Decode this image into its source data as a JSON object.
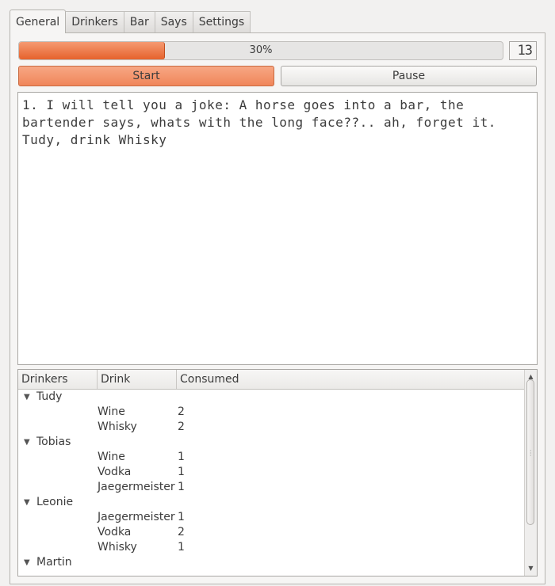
{
  "tabs": [
    {
      "label": "General",
      "active": true
    },
    {
      "label": "Drinkers",
      "active": false
    },
    {
      "label": "Bar",
      "active": false
    },
    {
      "label": "Says",
      "active": false
    },
    {
      "label": "Settings",
      "active": false
    }
  ],
  "progress": {
    "value": 0.3,
    "text": "30%"
  },
  "lcd": {
    "value": "13"
  },
  "buttons": {
    "start": "Start",
    "pause": "Pause"
  },
  "log": {
    "text": "1. I will tell you a joke: A horse goes into a bar, the bartender says, whats with the long face??.. ah, forget it. Tudy, drink Whisky"
  },
  "tree": {
    "columns": [
      "Drinkers",
      "Drink",
      "Consumed"
    ],
    "drinkers": [
      {
        "name": "Tudy",
        "drinks": [
          {
            "drink": "Wine",
            "consumed": "2"
          },
          {
            "drink": "Whisky",
            "consumed": "2"
          }
        ]
      },
      {
        "name": "Tobias",
        "drinks": [
          {
            "drink": "Wine",
            "consumed": "1"
          },
          {
            "drink": "Vodka",
            "consumed": "1"
          },
          {
            "drink": "Jaegermeister",
            "consumed": "1"
          }
        ]
      },
      {
        "name": "Leonie",
        "drinks": [
          {
            "drink": "Jaegermeister",
            "consumed": "1"
          },
          {
            "drink": "Vodka",
            "consumed": "2"
          },
          {
            "drink": "Whisky",
            "consumed": "1"
          }
        ]
      },
      {
        "name": "Martin",
        "drinks": []
      }
    ]
  },
  "colors": {
    "accent": "#e6622c",
    "button_active": "#f0865a"
  }
}
